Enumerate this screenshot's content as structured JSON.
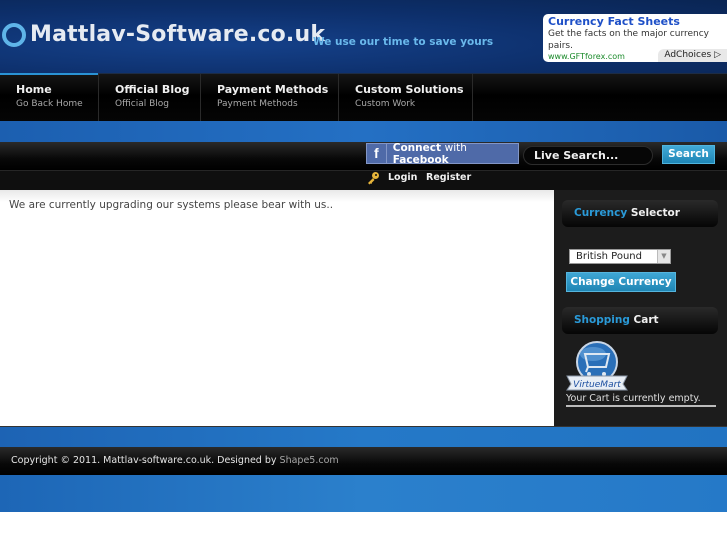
{
  "header": {
    "site_title": "Mattlav-Software.co.uk",
    "tagline": "We use our time to save yours"
  },
  "ad": {
    "title": "Currency Fact Sheets",
    "body": "Get the facts on the major currency pairs.",
    "url": "www.GFTforex.com",
    "choices_label": "AdChoices ▷"
  },
  "nav": {
    "items": [
      {
        "label": "Home",
        "sub": "Go Back Home",
        "active": true
      },
      {
        "label": "Official Blog",
        "sub": "Official Blog"
      },
      {
        "label": "Payment Methods",
        "sub": "Payment Methods"
      },
      {
        "label": "Custom Solutions",
        "sub": "Custom Work"
      }
    ]
  },
  "toolbar": {
    "facebook_connect": "Connect",
    "facebook_with": "with",
    "facebook_brand": "Facebook",
    "search_placeholder": "Live Search...",
    "search_label": "Search",
    "login_label": "Login",
    "register_label": "Register"
  },
  "main": {
    "message": "We are currently upgrading our systems please bear with us.."
  },
  "sidebar": {
    "currency": {
      "title_highlight": "Currency",
      "title_rest": "Selector",
      "selected": "British Pound",
      "button_label": "Change Currency"
    },
    "cart": {
      "title_highlight": "Shopping",
      "title_rest": "Cart",
      "logo_label": "VirtueMart",
      "empty_text": "Your Cart is currently empty."
    }
  },
  "footer": {
    "copyright": "Copyright © 2011. Mattlav-software.co.uk. Designed by ",
    "designer_link": "Shape5.com"
  }
}
